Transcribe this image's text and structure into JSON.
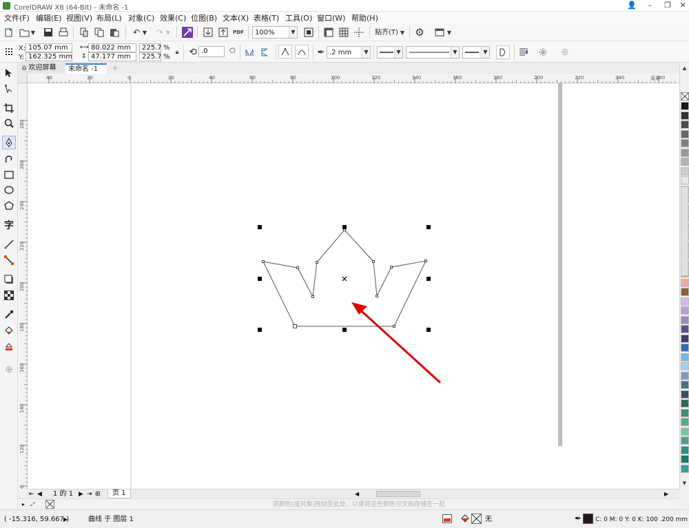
{
  "window": {
    "title": "CorelDRAW X8 (64-Bit) - 未命名 -1",
    "controls": [
      "👤",
      "–",
      "❐",
      "✕"
    ]
  },
  "menu": [
    "文件(F)",
    "编辑(E)",
    "视图(V)",
    "布局(L)",
    "对象(C)",
    "效果(C)",
    "位图(B)",
    "文本(X)",
    "表格(T)",
    "工具(O)",
    "窗口(W)",
    "帮助(H)"
  ],
  "standard_toolbar": {
    "zoom": "100%",
    "pdf_label": "PDF",
    "snap_label": "贴齐(T)"
  },
  "property_bar": {
    "x_label": "X:",
    "x_value": "105.07 mm",
    "y_label": "Y:",
    "y_value": "162.325 mm",
    "w_value": "80.022 mm",
    "h_value": "47.177 mm",
    "scale_w": "225.7",
    "scale_h": "225.7",
    "percent": "%",
    "rotation": ".0",
    "outline_width": ".2 mm"
  },
  "tabs": [
    "欢迎屏幕",
    "未命名 -1"
  ],
  "ruler_h_labels": [
    "40",
    "20",
    "0",
    "20",
    "40",
    "60",
    "80",
    "100",
    "120",
    "140",
    "160",
    "180",
    "200",
    "220",
    "240",
    "260"
  ],
  "ruler_h_unit": "毫米",
  "ruler_v_labels": [
    "280",
    "260",
    "240",
    "220",
    "200",
    "180",
    "160",
    "140",
    "120",
    "100",
    "80"
  ],
  "page_nav": {
    "counter": "1 的 1",
    "page_tab": "页 1"
  },
  "color_hint": "将颜色(或对象)拖动至此处，以便将这些颜色与文档存储在一起",
  "status": {
    "coords": "( -15.316, 59.667 )",
    "object_info": "曲线 于 图层 1",
    "fill_none": "无",
    "outline_info": "C: 0 M: 0 Y: 0 K: 100  .200 mm"
  },
  "palette_colors": [
    "#1a1a1a",
    "#333333",
    "#4d4d4d",
    "#666666",
    "#808080",
    "#999999",
    "#b3b3b3",
    "#cccccc",
    "#e6e6e6",
    "#ffffff",
    "#1f1a8c",
    "#2a5fb0",
    "#00a0e9",
    "#00a650",
    "#fff200",
    "#ed1c24",
    "#ec008c",
    "#92278f",
    "#f7941d",
    "#f9a4a9",
    "#8c6239",
    "#d6b8e6",
    "#b9a0d6",
    "#9a8bc0",
    "#5e4f8a",
    "#3f3c6e",
    "#2d6fb6",
    "#6fb7e6",
    "#a8d0ef",
    "#7a9bbf",
    "#4b6c8c",
    "#3a4e60",
    "#2f6b55",
    "#3c8c70",
    "#5aa888",
    "#7dc0a0",
    "#4fa08a",
    "#2e8f80",
    "#1e7a70",
    "#36a0a0"
  ],
  "accent_color": "#e00000"
}
